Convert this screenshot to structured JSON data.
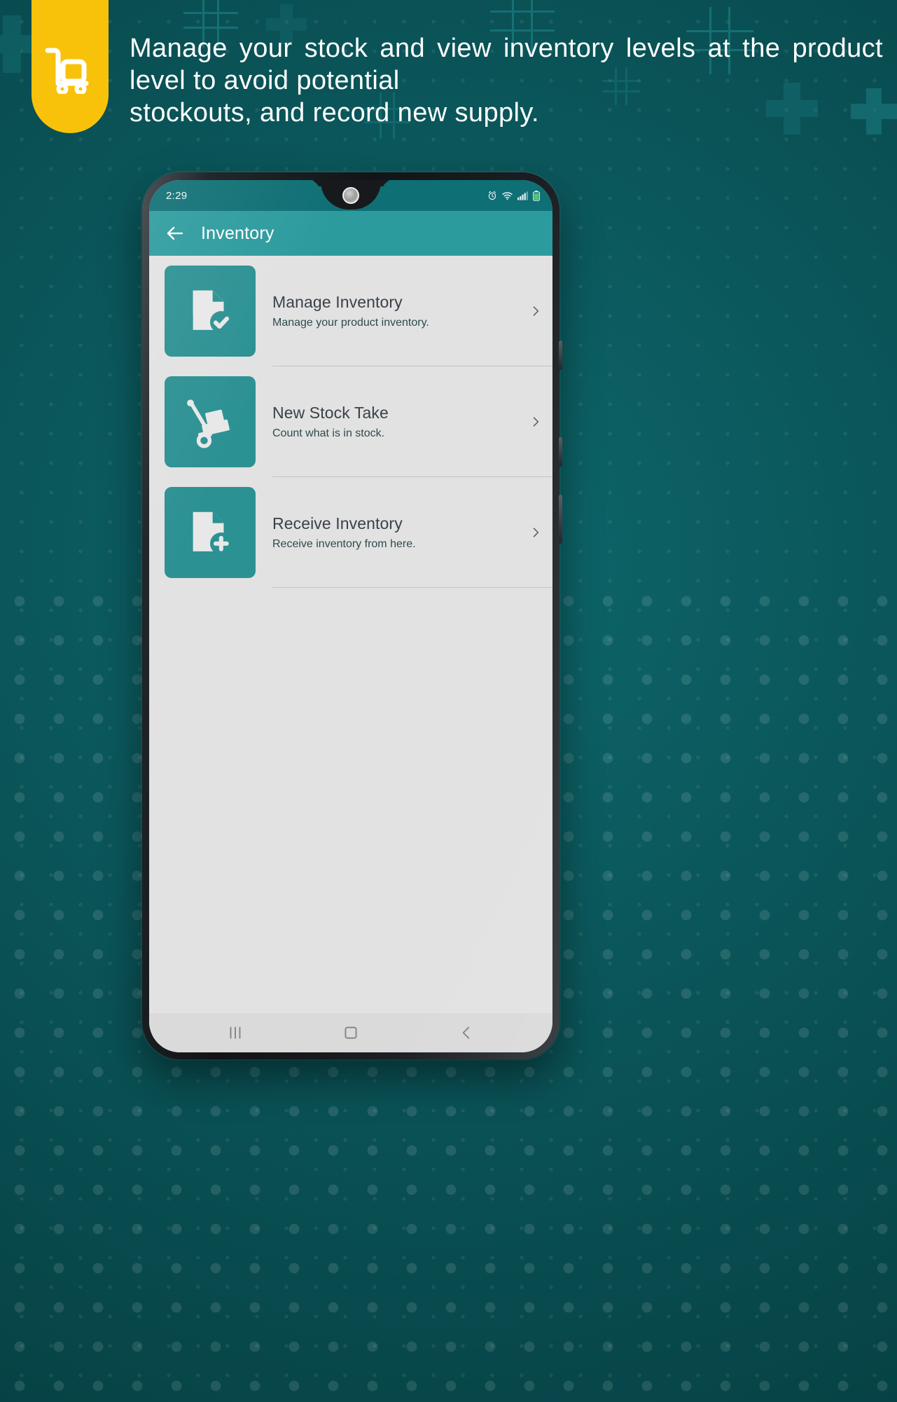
{
  "header": {
    "headline": "Manage your stock and view inventory levels at the product level to avoid potential",
    "headline_last": "stockouts, and record new supply.",
    "badge_icon": "hand-truck-icon",
    "badge_color": "#f9c20a",
    "background_color": "#0a5357"
  },
  "phone": {
    "status_bar": {
      "time": "2:29",
      "icons": [
        "alarm-icon",
        "wifi-icon",
        "signal-icon",
        "battery-icon"
      ],
      "background_color": "#0e6f74"
    },
    "app_bar": {
      "back_label": "back-arrow-icon",
      "title": "Inventory",
      "background_color": "#2c9b9e"
    },
    "list": {
      "items": [
        {
          "icon": "document-check-icon",
          "title": "Manage Inventory",
          "subtitle": "Manage your product inventory.",
          "chevron": "chevron-right-icon"
        },
        {
          "icon": "hand-truck-boxes-icon",
          "title": "New Stock Take",
          "subtitle": "Count what is in stock.",
          "chevron": "chevron-right-icon"
        },
        {
          "icon": "document-plus-icon",
          "title": "Receive Inventory",
          "subtitle": "Receive inventory from here.",
          "chevron": "chevron-right-icon"
        }
      ],
      "tile_color": "#2c9193",
      "background_color": "#e2e2e2"
    },
    "nav_bar": {
      "recents": "recents-icon",
      "home": "home-icon",
      "back": "back-icon"
    }
  }
}
